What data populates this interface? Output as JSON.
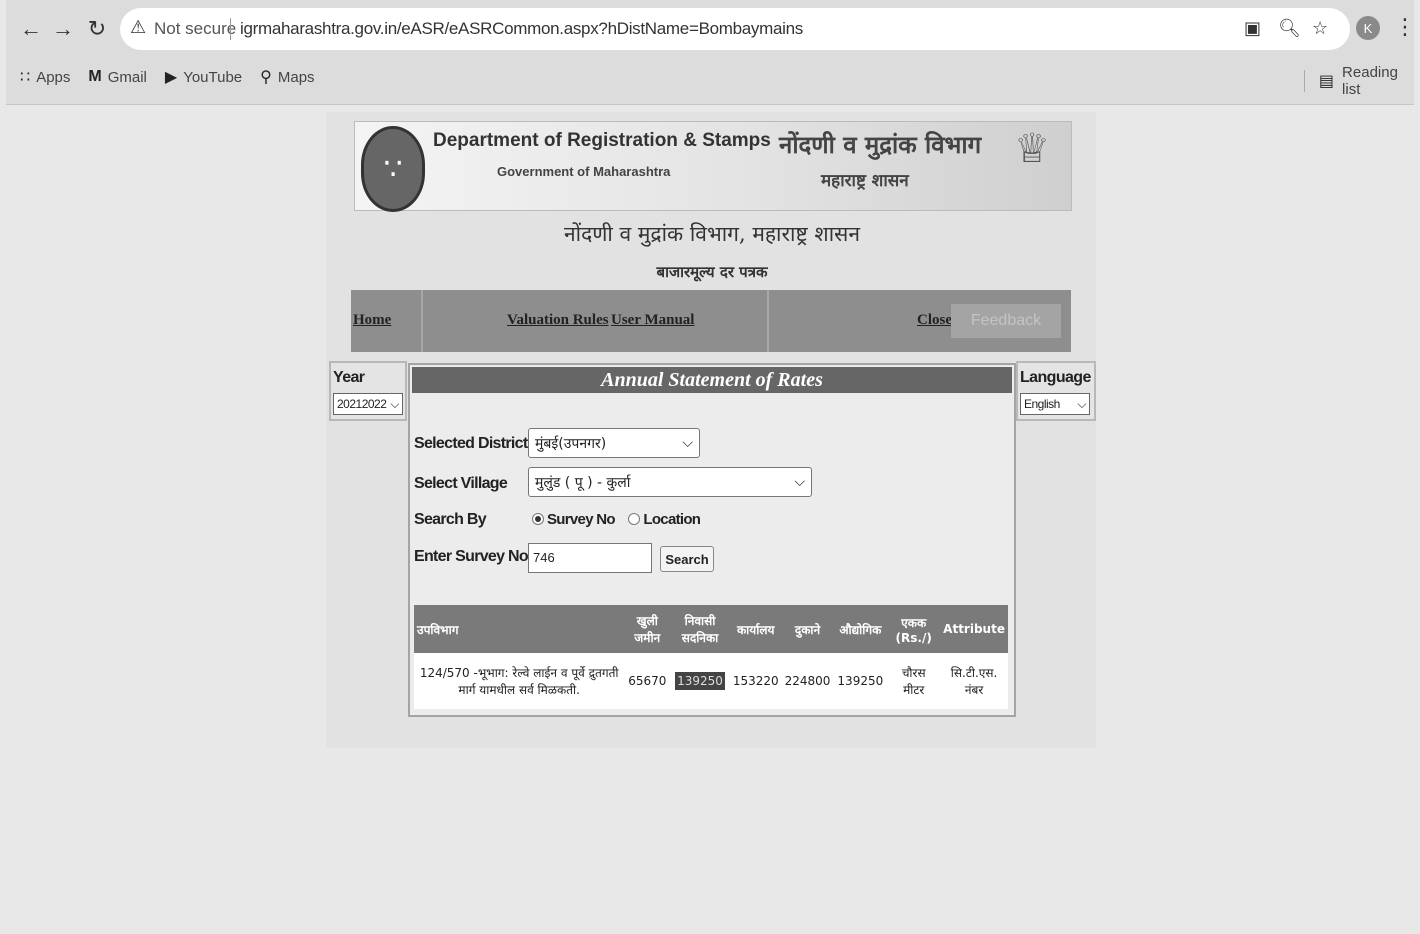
{
  "browser": {
    "security_label": "Not secure",
    "url": "igrmaharashtra.gov.in/eASR/eASRCommon.aspx?hDistName=Bombaymains",
    "profile_initial": "K",
    "bookmarks": [
      "Apps",
      "Gmail",
      "YouTube",
      "Maps"
    ],
    "reading_list": "Reading list"
  },
  "banner": {
    "dept_en": "Department of Registration & Stamps",
    "govt_en": "Government of Maharashtra",
    "dept_mr": "नोंदणी व मुद्रांक विभाग",
    "govt_mr": "महाराष्ट्र शासन"
  },
  "page": {
    "title_mr": "नोंदणी व मुद्रांक विभाग, महाराष्ट्र शासन",
    "subtitle_mr": "बाजारमूल्य दर पत्रक"
  },
  "nav": {
    "home": "Home",
    "valuation_rules": "Valuation Rules",
    "user_manual": "User Manual",
    "close": "Close",
    "feedback": "Feedback"
  },
  "year": {
    "label": "Year",
    "selected": "20212022"
  },
  "language": {
    "label": "Language",
    "selected": "English"
  },
  "panel": {
    "heading": "Annual Statement of Rates",
    "district_label": "Selected District",
    "district_value": "मुंबई(उपनगर)",
    "village_label": "Select Village",
    "village_value": "मुलुंड ( पू ) - कुर्ला",
    "search_by_label": "Search By",
    "search_by_options": [
      "Survey No",
      "Location"
    ],
    "search_by_selected": "Survey No",
    "survey_label": "Enter Survey No",
    "survey_value": "746",
    "search_button": "Search"
  },
  "table": {
    "headers": [
      "उपविभाग",
      "खुली जमीन",
      "निवासी सदनिका",
      "कार्यालय",
      "दुकाने",
      "औद्योगिक",
      "एकक (Rs./)",
      "Attribute"
    ],
    "rows": [
      [
        "124/570 -भूभाग: रेल्वे लाईन व पूर्वे द्रुतगती मार्ग यामधील सर्व मिळकती.",
        "65670",
        "139250",
        "153220",
        "224800",
        "139250",
        "चौरस मीटर",
        "सि.टी.एस. नंबर"
      ]
    ]
  }
}
